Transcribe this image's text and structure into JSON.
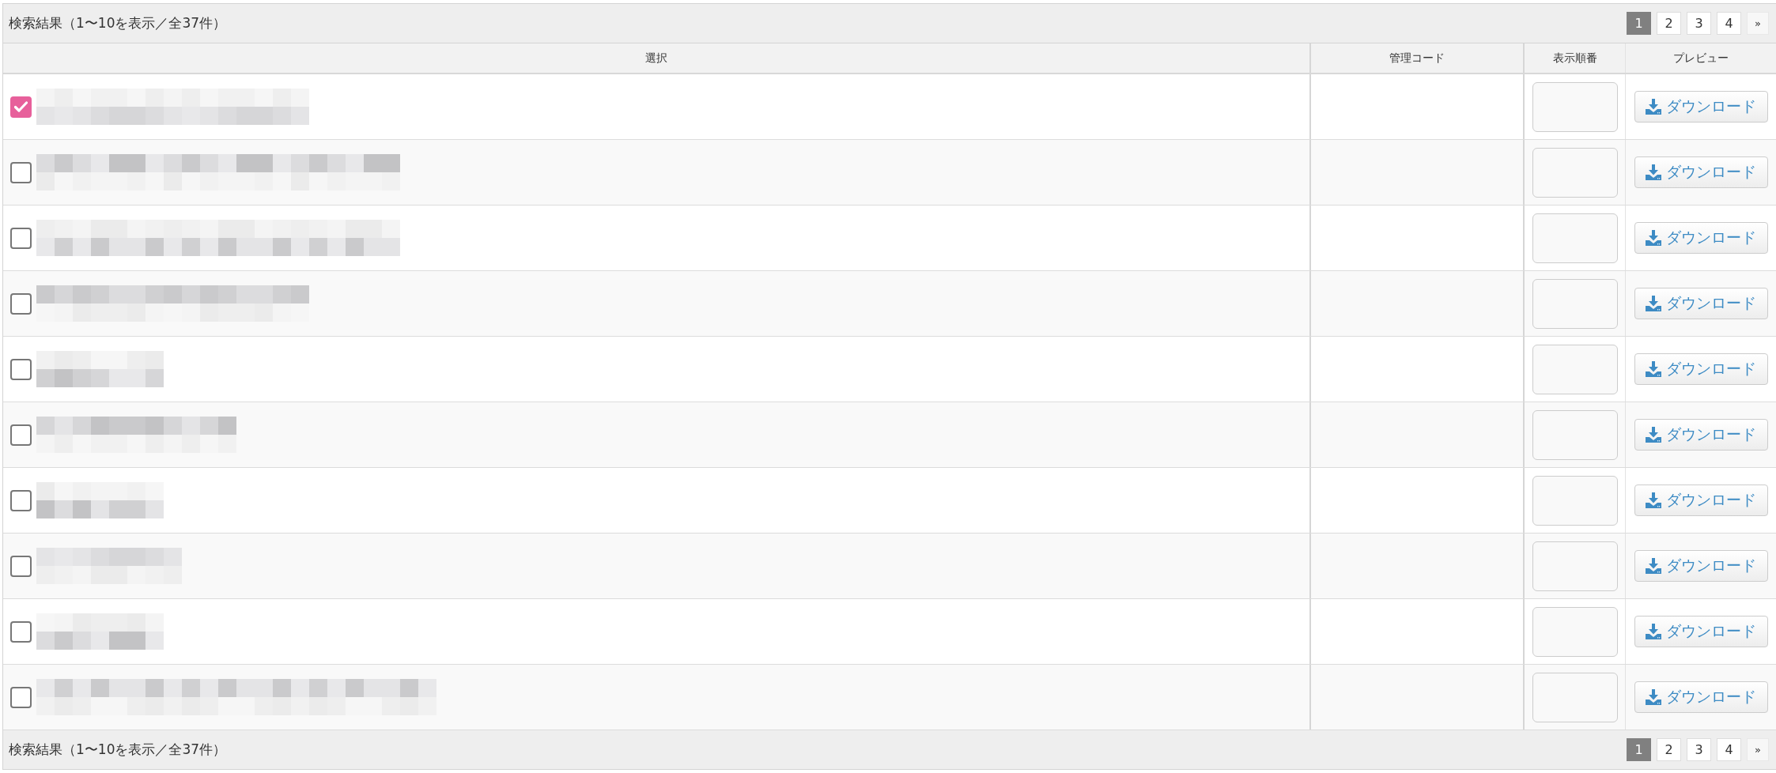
{
  "pager_top": {
    "summary": "検索結果（1〜10を表示／全37件）",
    "pages": [
      {
        "label": "1",
        "selected": true
      },
      {
        "label": "2",
        "selected": false
      },
      {
        "label": "3",
        "selected": false
      },
      {
        "label": "4",
        "selected": false
      }
    ],
    "next": "»"
  },
  "table": {
    "columns": [
      "選択",
      "管理コード",
      "表示順番",
      "プレビュー"
    ],
    "rows": [
      {
        "checked": true,
        "button": "ダウンロード"
      },
      {
        "checked": false,
        "button": "ダウンロード"
      },
      {
        "checked": false,
        "button": "ダウンロード"
      },
      {
        "checked": false,
        "button": "ダウンロード"
      },
      {
        "checked": false,
        "button": "ダウンロード"
      },
      {
        "checked": false,
        "button": "ダウンロード"
      },
      {
        "checked": false,
        "button": "ダウンロード"
      },
      {
        "checked": false,
        "button": "ダウンロード"
      },
      {
        "checked": false,
        "button": "ダウンロード"
      },
      {
        "checked": false,
        "button": "ダウンロード"
      }
    ]
  },
  "pager_bottom": {
    "summary": "検索結果（1〜10を表示／全37件）",
    "pages": [
      {
        "label": "1",
        "selected": true
      },
      {
        "label": "2",
        "selected": false
      },
      {
        "label": "3",
        "selected": false
      },
      {
        "label": "4",
        "selected": false
      }
    ],
    "next": "»"
  }
}
